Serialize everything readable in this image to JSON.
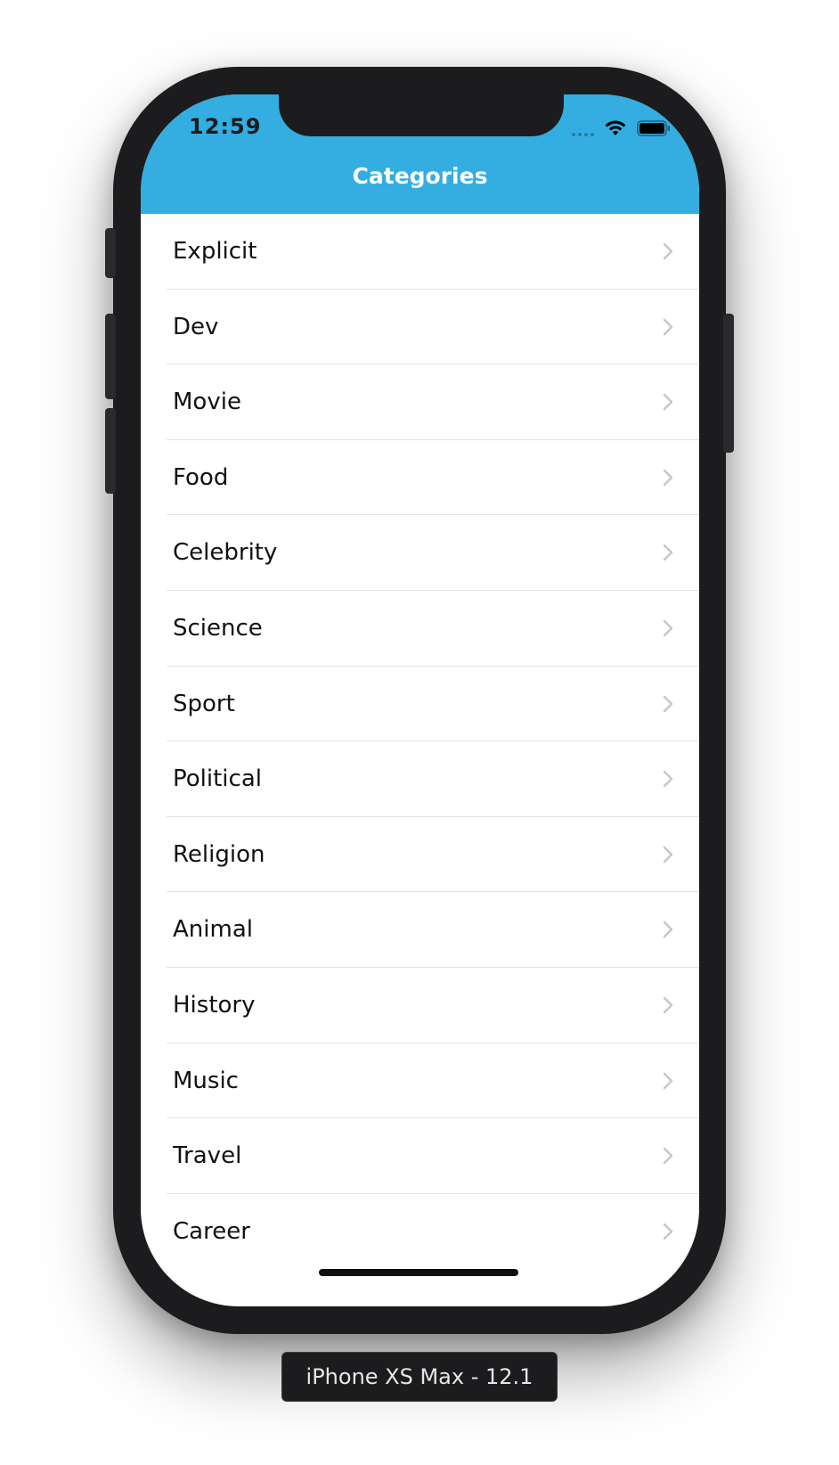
{
  "status_bar": {
    "time": "12:59"
  },
  "nav": {
    "title": "Categories"
  },
  "categories": [
    {
      "label": "Explicit"
    },
    {
      "label": "Dev"
    },
    {
      "label": "Movie"
    },
    {
      "label": "Food"
    },
    {
      "label": "Celebrity"
    },
    {
      "label": "Science"
    },
    {
      "label": "Sport"
    },
    {
      "label": "Political"
    },
    {
      "label": "Religion"
    },
    {
      "label": "Animal"
    },
    {
      "label": "History"
    },
    {
      "label": "Music"
    },
    {
      "label": "Travel"
    },
    {
      "label": "Career"
    }
  ],
  "simulator": {
    "device_label": "iPhone XS Max - 12.1"
  },
  "colors": {
    "nav_bar": "#34ade0",
    "device_frame": "#1c1c1e",
    "chevron": "#c7c7cc"
  }
}
